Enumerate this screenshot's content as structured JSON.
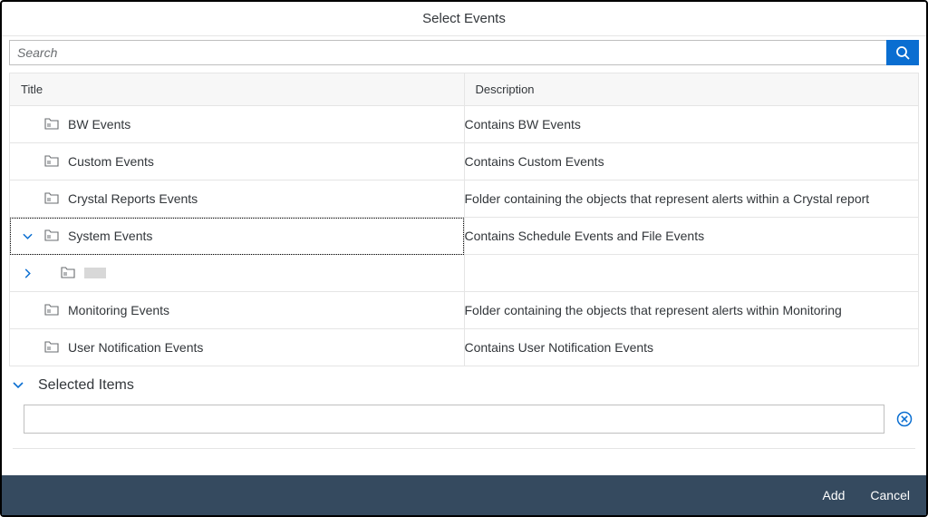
{
  "dialog": {
    "title": "Select Events"
  },
  "search": {
    "placeholder": "Search"
  },
  "table": {
    "headers": {
      "title": "Title",
      "description": "Description"
    },
    "rows": [
      {
        "expand": null,
        "indent": 0,
        "title": "BW Events",
        "description": "Contains BW Events"
      },
      {
        "expand": null,
        "indent": 0,
        "title": "Custom Events",
        "description": "Contains Custom Events"
      },
      {
        "expand": null,
        "indent": 0,
        "title": "Crystal Reports Events",
        "description": "Folder containing the objects that represent alerts within a Crystal report"
      },
      {
        "expand": "down",
        "indent": 0,
        "title": "System Events",
        "description": "Contains Schedule Events and File Events",
        "selected": true
      },
      {
        "expand": "right",
        "indent": 1,
        "title": "",
        "obscured": true,
        "description": ""
      },
      {
        "expand": null,
        "indent": 0,
        "title": "Monitoring Events",
        "description": "Folder containing the objects that represent alerts within Monitoring"
      },
      {
        "expand": null,
        "indent": 0,
        "title": "User Notification Events",
        "description": "Contains User Notification Events"
      }
    ]
  },
  "selected": {
    "heading": "Selected Items",
    "value": ""
  },
  "footer": {
    "add": "Add",
    "cancel": "Cancel"
  }
}
